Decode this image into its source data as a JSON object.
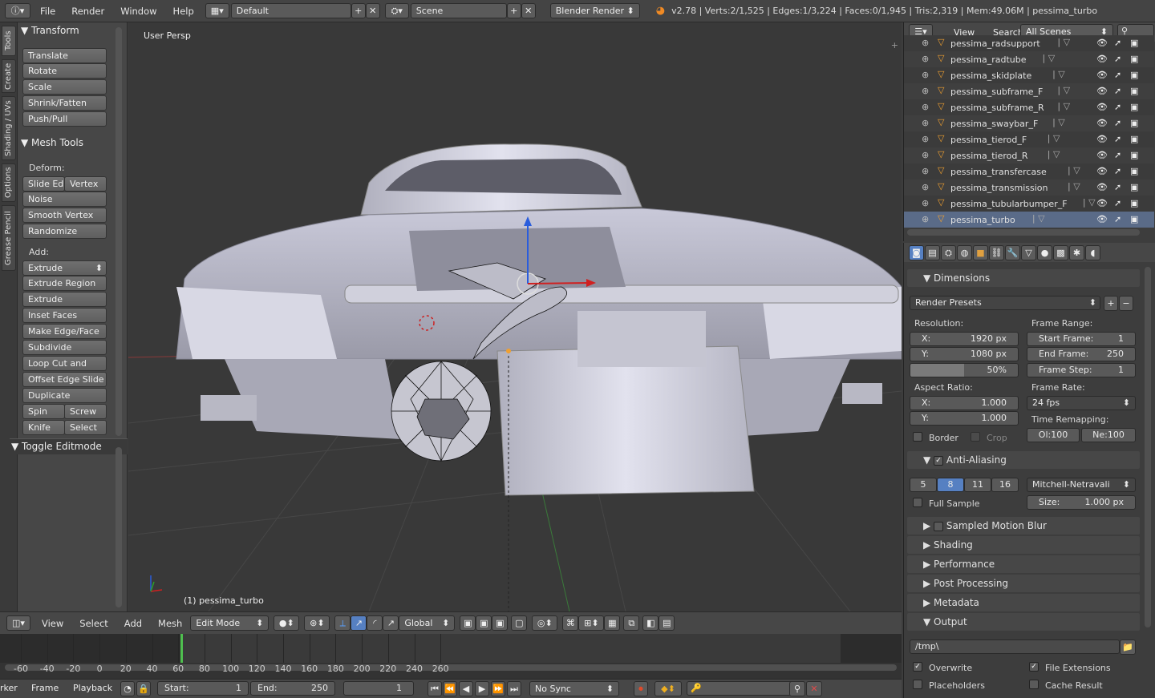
{
  "topbar": {
    "menus": [
      "File",
      "Render",
      "Window",
      "Help"
    ],
    "layout": "Default",
    "scene": "Scene",
    "engine": "Blender Render",
    "stats": "v2.78 | Verts:2/1,525 | Edges:1/3,224 | Faces:0/1,945 | Tris:2,319 | Mem:49.06M | pessima_turbo"
  },
  "lefttabs": [
    "Tools",
    "Create",
    "Shading / UVs",
    "Options",
    "Grease Pencil"
  ],
  "tools": {
    "transform_title": "Transform",
    "transform": [
      "Translate",
      "Rotate",
      "Scale",
      "Shrink/Fatten",
      "Push/Pull"
    ],
    "mesh_title": "Mesh Tools",
    "deform_label": "Deform:",
    "slide_edge": "Slide Ed",
    "vertex": "Vertex",
    "noise": "Noise",
    "smooth_vertex": "Smooth Vertex",
    "randomize": "Randomize",
    "add_label": "Add:",
    "extrude": "Extrude",
    "add": [
      "Extrude Region",
      "Extrude Individual",
      "Inset Faces",
      "Make Edge/Face",
      "Subdivide",
      "Loop Cut and Slide",
      "Offset Edge Slide",
      "Duplicate"
    ],
    "spin": "Spin",
    "screw": "Screw",
    "knife": "Knife",
    "select": "Select",
    "toggle": "Toggle Editmode"
  },
  "viewport": {
    "view_name": "User Persp",
    "object_name": "(1) pessima_turbo"
  },
  "vheader": {
    "view": "View",
    "select": "Select",
    "add": "Add",
    "mesh": "Mesh",
    "mode": "Edit Mode",
    "orientation": "Global"
  },
  "timeline": {
    "ticks": [
      "-60",
      "-40",
      "-20",
      "0",
      "20",
      "40",
      "60",
      "80",
      "100",
      "120",
      "140",
      "160",
      "180",
      "200",
      "220",
      "240",
      "260"
    ]
  },
  "tlbar": {
    "marker": "rker",
    "frame": "Frame",
    "playback": "Playback",
    "start_label": "Start:",
    "start": "1",
    "end_label": "End:",
    "end": "250",
    "current": "1",
    "sync": "No Sync"
  },
  "outliner": {
    "view": "View",
    "search": "Search",
    "scenes": "All Scenes",
    "items": [
      "pessima_radsupport",
      "pessima_radtube",
      "pessima_skidplate",
      "pessima_subframe_F",
      "pessima_subframe_R",
      "pessima_swaybar_F",
      "pessima_tierod_F",
      "pessima_tierod_R",
      "pessima_transfercase",
      "pessima_transmission",
      "pessima_tubularbumper_F",
      "pessima_turbo"
    ]
  },
  "props": {
    "dimensions": "Dimensions",
    "render_presets": "Render Presets",
    "resolution": "Resolution:",
    "res_x_label": "X:",
    "res_x": "1920 px",
    "res_y_label": "Y:",
    "res_y": "1080 px",
    "res_pct": "50%",
    "frame_range": "Frame Range:",
    "start_frame_label": "Start Frame:",
    "start_frame": "1",
    "end_frame_label": "End Frame:",
    "end_frame": "250",
    "frame_step_label": "Frame Step:",
    "frame_step": "1",
    "aspect": "Aspect Ratio:",
    "asp_x_label": "X:",
    "asp_x": "1.000",
    "asp_y_label": "Y:",
    "asp_y": "1.000",
    "frame_rate": "Frame Rate:",
    "fps": "24 fps",
    "time_remap": "Time Remapping:",
    "old": "Ol:100",
    "new": "Ne:100",
    "border": "Border",
    "crop": "Crop",
    "aa": "Anti-Aliasing",
    "aa_samples": [
      "5",
      "8",
      "11",
      "16"
    ],
    "filter": "Mitchell-Netravali",
    "full_sample": "Full Sample",
    "size_label": "Size:",
    "size": "1.000 px",
    "motion_blur": "Sampled Motion Blur",
    "shading": "Shading",
    "performance": "Performance",
    "post": "Post Processing",
    "metadata": "Metadata",
    "output": "Output",
    "path": "/tmp\\",
    "overwrite": "Overwrite",
    "file_ext": "File Extensions",
    "placeholders": "Placeholders",
    "cache": "Cache Result"
  }
}
